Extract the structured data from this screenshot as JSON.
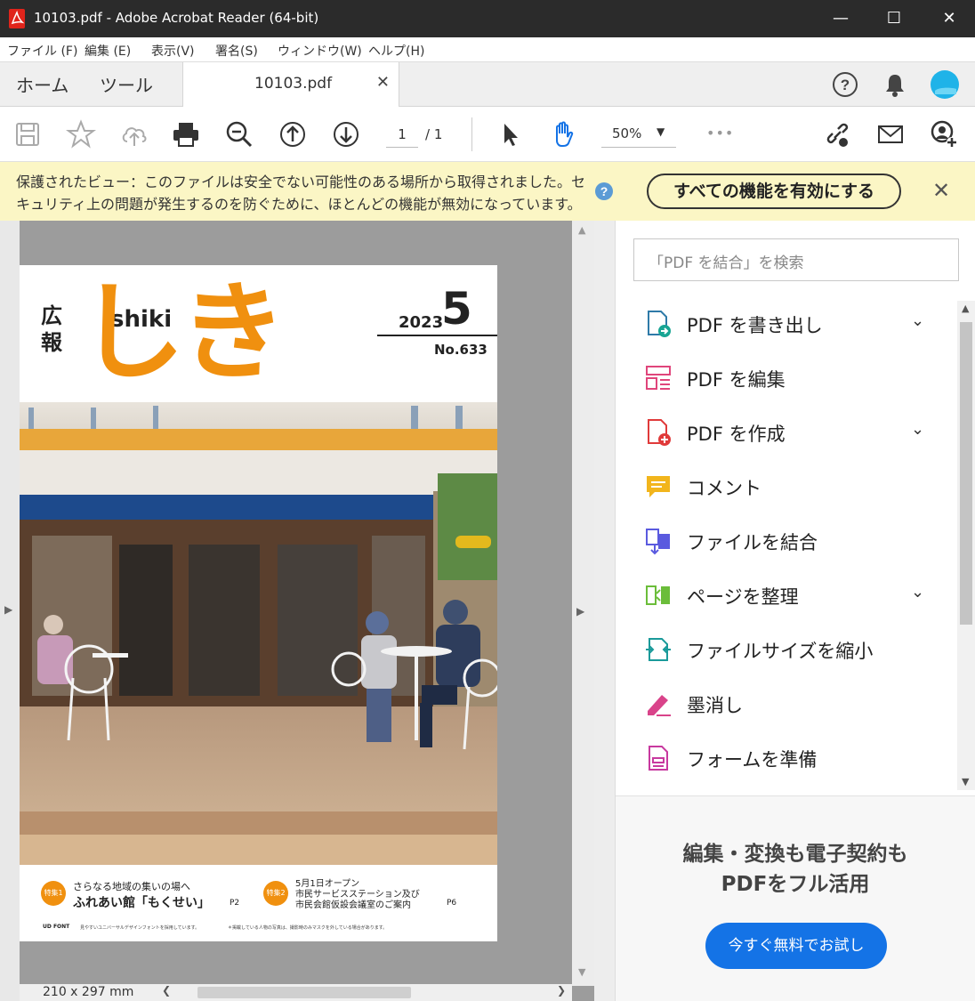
{
  "window": {
    "title": "10103.pdf - Adobe Acrobat Reader (64-bit)"
  },
  "menu": [
    "ファイル (F)",
    "編集 (E)",
    "表示(V)",
    "署名(S)",
    "ウィンドウ(W)",
    "ヘルプ(H)"
  ],
  "tabs": {
    "home": "ホーム",
    "tools": "ツール",
    "document": "10103.pdf"
  },
  "toolbar": {
    "page_current": "1",
    "page_total": "/ 1",
    "zoom": "50%",
    "more": "•••"
  },
  "protected_view": {
    "message": "保護されたビュー：このファイルは安全でない可能性のある場所から取得されました。セキュリティ上の問題が発生するのを防ぐために、ほとんどの機能が無効になっています。",
    "enable_button": "すべての機能を有効にする"
  },
  "document": {
    "page_size": "210 x 297 mm",
    "cover": {
      "kouhou": "広報",
      "shiki_latin": "shiki",
      "shiki_kana": "しき",
      "year": "2023",
      "month": "5",
      "issue": "No.633",
      "feature1_badge": "特集1",
      "feature1_line1": "さらなる地域の集いの場へ",
      "feature1_line2": "ふれあい館「もくせい」",
      "feature1_page": "P2",
      "feature2_badge": "特集2",
      "feature2_line1": "5月1日オープン",
      "feature2_line2": "市民サービスステーション及び",
      "feature2_line3": "市民会館仮設会議室のご案内",
      "feature2_page": "P6",
      "udfont": "UD FONT",
      "footnote1": "見やすいユニバーサルデザインフォントを採用しています。",
      "footnote2": "＊掲載している人物の写真は、撮影時のみマスクを外している場合があります。"
    }
  },
  "tools_panel": {
    "search_placeholder": "「PDF を結合」を検索",
    "items": [
      {
        "label": "PDF を書き出し",
        "expandable": true
      },
      {
        "label": "PDF を編集",
        "expandable": false
      },
      {
        "label": "PDF を作成",
        "expandable": true
      },
      {
        "label": "コメント",
        "expandable": false
      },
      {
        "label": "ファイルを結合",
        "expandable": false
      },
      {
        "label": "ページを整理",
        "expandable": true
      },
      {
        "label": "ファイルサイズを縮小",
        "expandable": false
      },
      {
        "label": "墨消し",
        "expandable": false
      },
      {
        "label": "フォームを準備",
        "expandable": false
      }
    ],
    "promo_line1": "編集・変換も電子契約も",
    "promo_line2": "PDFをフル活用",
    "trial_button": "今すぐ無料でお試し"
  },
  "colors": {
    "titlebar": "#2b2b2b",
    "warning_bg": "#fbf6c5",
    "accent_blue": "#1473e6",
    "shiki_orange": "#f0900f",
    "doc_gray": "#9c9c9c"
  }
}
